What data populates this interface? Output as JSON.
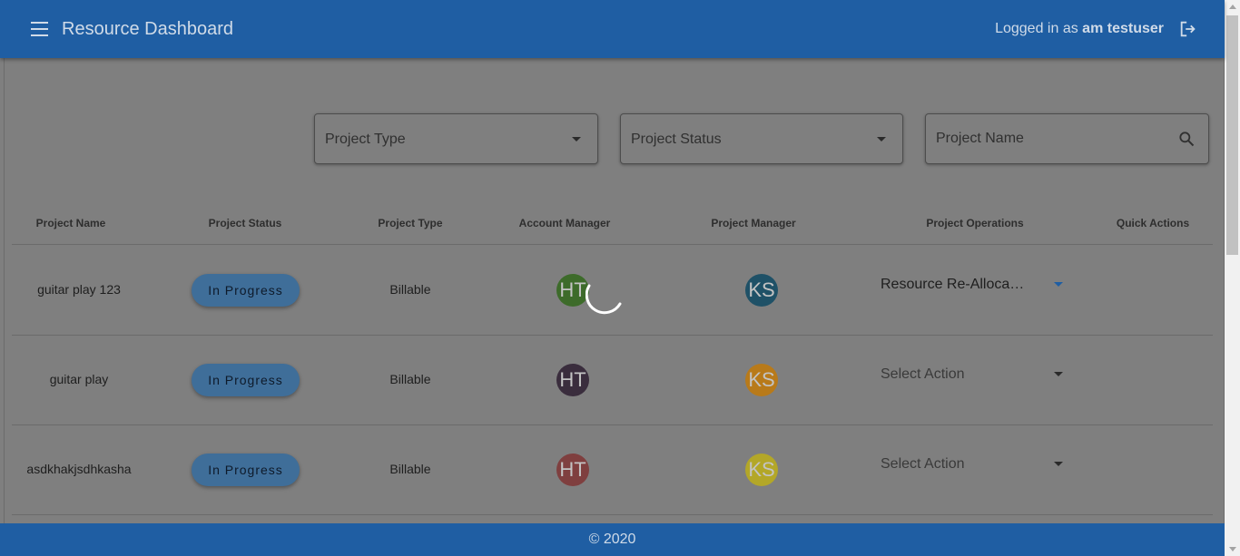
{
  "header": {
    "title": "Resource Dashboard",
    "logged_in_prefix": "Logged in as",
    "username": "am testuser"
  },
  "filters": {
    "project_type_label": "Project Type",
    "project_status_label": "Project Status",
    "project_name_placeholder": "Project Name"
  },
  "table": {
    "columns": [
      "Project Name",
      "Project Status",
      "Project Type",
      "Account Manager",
      "Project Manager",
      "Project Operations",
      "Quick Actions"
    ],
    "rows": [
      {
        "name": "guitar play 123",
        "status": "In Progress",
        "type": "Billable",
        "account_manager": "HT",
        "am_color": "#3d6b2a",
        "project_manager": "KS",
        "pm_color": "#1f5167",
        "operation": "Resource Re-Allocati...",
        "operation_selected": true
      },
      {
        "name": "guitar play",
        "status": "In Progress",
        "type": "Billable",
        "account_manager": "HT",
        "am_color": "#3a2d3d",
        "project_manager": "KS",
        "pm_color": "#b87a1a",
        "operation": "Select Action",
        "operation_selected": false
      },
      {
        "name": "asdkhakjsdhkasha",
        "status": "In Progress",
        "type": "Billable",
        "account_manager": "HT",
        "am_color": "#7f3f3f",
        "project_manager": "KS",
        "pm_color": "#b3a728",
        "operation": "Select Action",
        "operation_selected": false
      }
    ]
  },
  "footer": {
    "text": "© 2020"
  },
  "icons": {
    "menu": "menu-icon",
    "logout": "logout-icon",
    "search": "search-icon",
    "dropdown": "caret-down-icon",
    "loading": "spinner-icon"
  },
  "colors": {
    "primary": "#1f5ea3",
    "chip": "#3f6e99",
    "backdrop": "#7f7f7f"
  }
}
